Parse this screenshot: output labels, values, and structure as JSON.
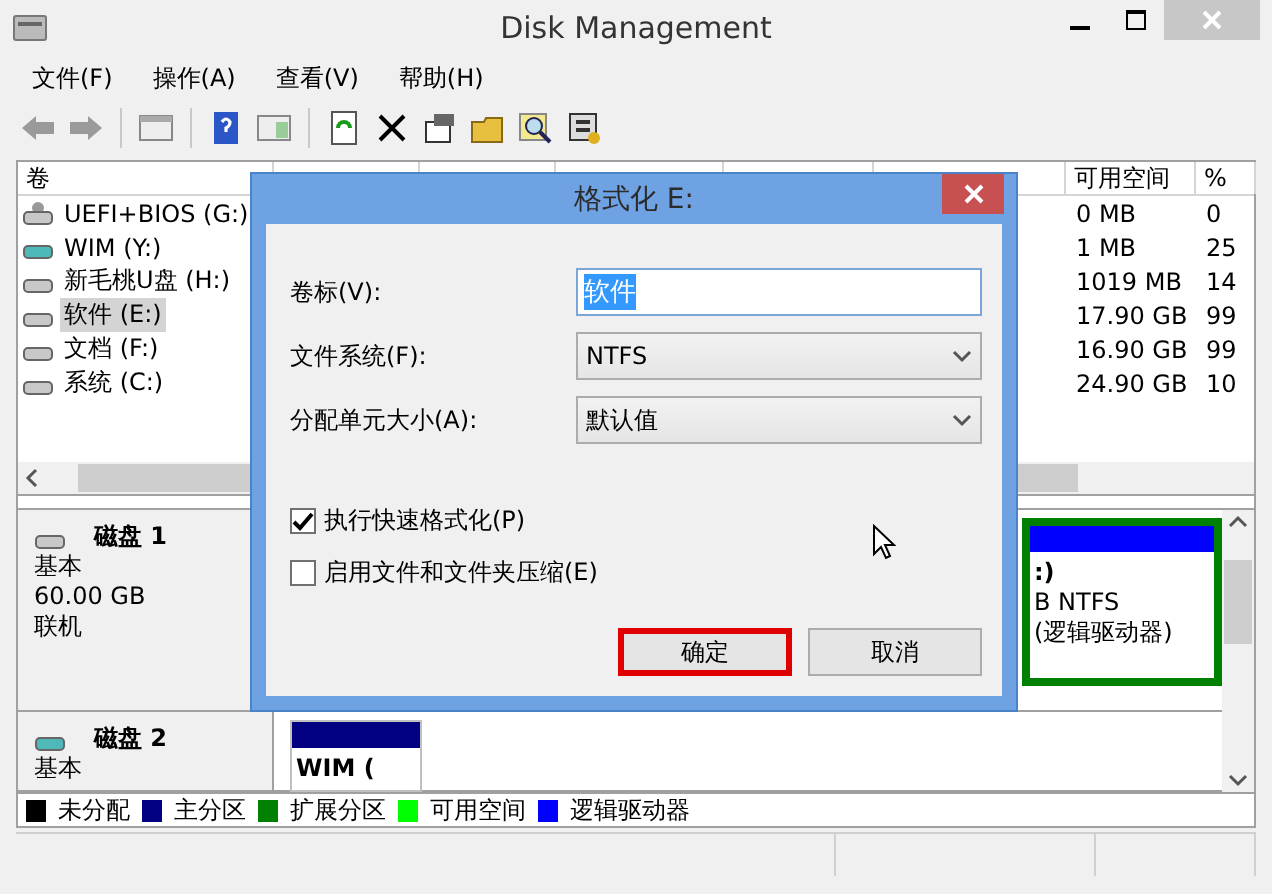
{
  "window": {
    "title": "Disk Management"
  },
  "menu": [
    "文件(F)",
    "操作(A)",
    "查看(V)",
    "帮助(H)"
  ],
  "volume_table": {
    "first_column": "卷",
    "free_column": "可用空间",
    "percent_column": "%",
    "rows": [
      {
        "name": "UEFI+BIOS (G:)",
        "free": "0 MB",
        "percent": "0",
        "kind": "removable",
        "selected": false
      },
      {
        "name": "WIM (Y:)",
        "free": "1 MB",
        "percent": "25",
        "kind": "virtual",
        "selected": false
      },
      {
        "name": "新毛桃U盘 (H:)",
        "free": "1019 MB",
        "percent": "14",
        "kind": "drive",
        "selected": false
      },
      {
        "name": "软件 (E:)",
        "free": "17.90 GB",
        "percent": "99",
        "kind": "drive",
        "selected": true
      },
      {
        "name": "文档 (F:)",
        "free": "16.90 GB",
        "percent": "99",
        "kind": "drive",
        "selected": false
      },
      {
        "name": "系统 (C:)",
        "free": "24.90 GB",
        "percent": "10",
        "kind": "drive",
        "selected": false
      }
    ]
  },
  "disks": [
    {
      "name": "磁盘 1",
      "type": "基本",
      "size": "60.00 GB",
      "status": "联机",
      "kind": "drive",
      "partitions": [
        {
          "kind": "logical",
          "lines": [
            ":)",
            "B NTFS",
            "(逻辑驱动器)"
          ]
        }
      ]
    },
    {
      "name": "磁盘 2",
      "type": "基本",
      "kind": "virtual",
      "partitions": [
        {
          "kind": "primary",
          "lines": [
            "WIM ("
          ]
        }
      ]
    }
  ],
  "legend": [
    {
      "label": "未分配",
      "color": "#000000"
    },
    {
      "label": "主分区",
      "color": "#000080"
    },
    {
      "label": "扩展分区",
      "color": "#008000"
    },
    {
      "label": "可用空间",
      "color": "#00ff00"
    },
    {
      "label": "逻辑驱动器",
      "color": "#0000ff"
    }
  ],
  "dialog": {
    "title": "格式化 E:",
    "fields": [
      {
        "kind": "text",
        "label": "卷标(V):",
        "value": "软件",
        "value_selected": true
      },
      {
        "kind": "select",
        "label": "文件系统(F):",
        "value": "NTFS"
      },
      {
        "kind": "select",
        "label": "分配单元大小(A):",
        "value": "默认值"
      }
    ],
    "options": [
      {
        "label": "执行快速格式化(P)",
        "checked": true
      },
      {
        "label": "启用文件和文件夹压缩(E)",
        "checked": false
      }
    ],
    "buttons": [
      {
        "label": "确定",
        "highlighted": true
      },
      {
        "label": "取消",
        "highlighted": false
      }
    ]
  }
}
